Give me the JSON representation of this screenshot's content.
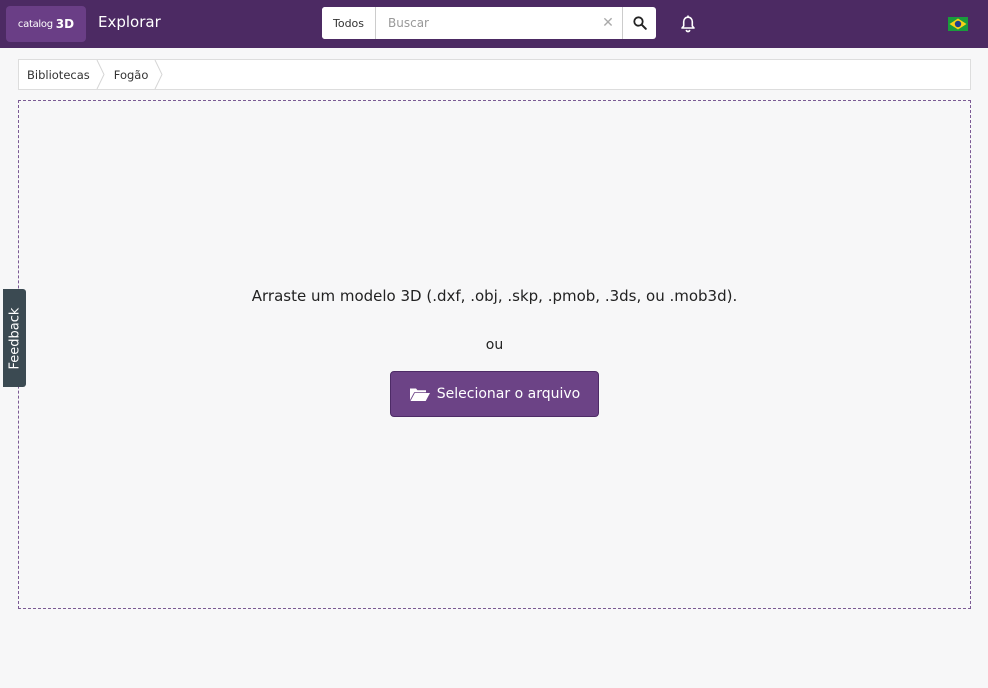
{
  "header": {
    "logo": {
      "small": "catalog",
      "big": "3D"
    },
    "nav_label": "Explorar",
    "search": {
      "scope": "Todos",
      "placeholder": "Buscar",
      "value": ""
    },
    "icons": [
      "clear-icon",
      "search-icon",
      "bell-icon",
      "brazil-flag-icon"
    ]
  },
  "breadcrumb": [
    "Bibliotecas",
    "Fogão"
  ],
  "upload": {
    "instruction": "Arraste um modelo 3D (.dxf, .obj, .skp, .pmob, .3ds, ou .mob3d).",
    "or": "ou",
    "button_label": "Selecionar o arquivo",
    "button_icon": "folder-open-icon"
  },
  "feedback_label": "Feedback",
  "colors": {
    "header_bg": "#4c2a63",
    "button_bg": "#6c4386",
    "dashed_border": "#7b5a94",
    "feedback_bg": "#3b4a52"
  }
}
